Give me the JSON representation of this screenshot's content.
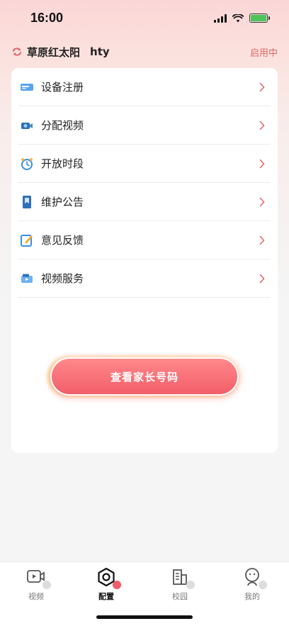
{
  "status_bar": {
    "time": "16:00",
    "battery_color": "#4cc45a"
  },
  "header": {
    "school_name": "草原红太阳",
    "user_name": "hty",
    "status": "启用中",
    "accent_color": "#e0666a",
    "switch_icon": "switch-icon"
  },
  "menu": {
    "items": [
      {
        "label": "设备注册",
        "icon": "device-card-icon"
      },
      {
        "label": "分配视频",
        "icon": "camera-icon"
      },
      {
        "label": "开放时段",
        "icon": "alarm-clock-icon"
      },
      {
        "label": "维护公告",
        "icon": "bookmark-icon"
      },
      {
        "label": "意见反馈",
        "icon": "edit-icon"
      },
      {
        "label": "视频服务",
        "icon": "video-service-icon"
      }
    ]
  },
  "cta": {
    "label": "查看家长号码",
    "color": "#f25c68"
  },
  "tabs": [
    {
      "label": "视频",
      "icon": "video-icon",
      "active": false
    },
    {
      "label": "配置",
      "icon": "settings-hex-icon",
      "active": true
    },
    {
      "label": "校园",
      "icon": "campus-building-icon",
      "active": false
    },
    {
      "label": "我的",
      "icon": "profile-icon",
      "active": false
    }
  ]
}
